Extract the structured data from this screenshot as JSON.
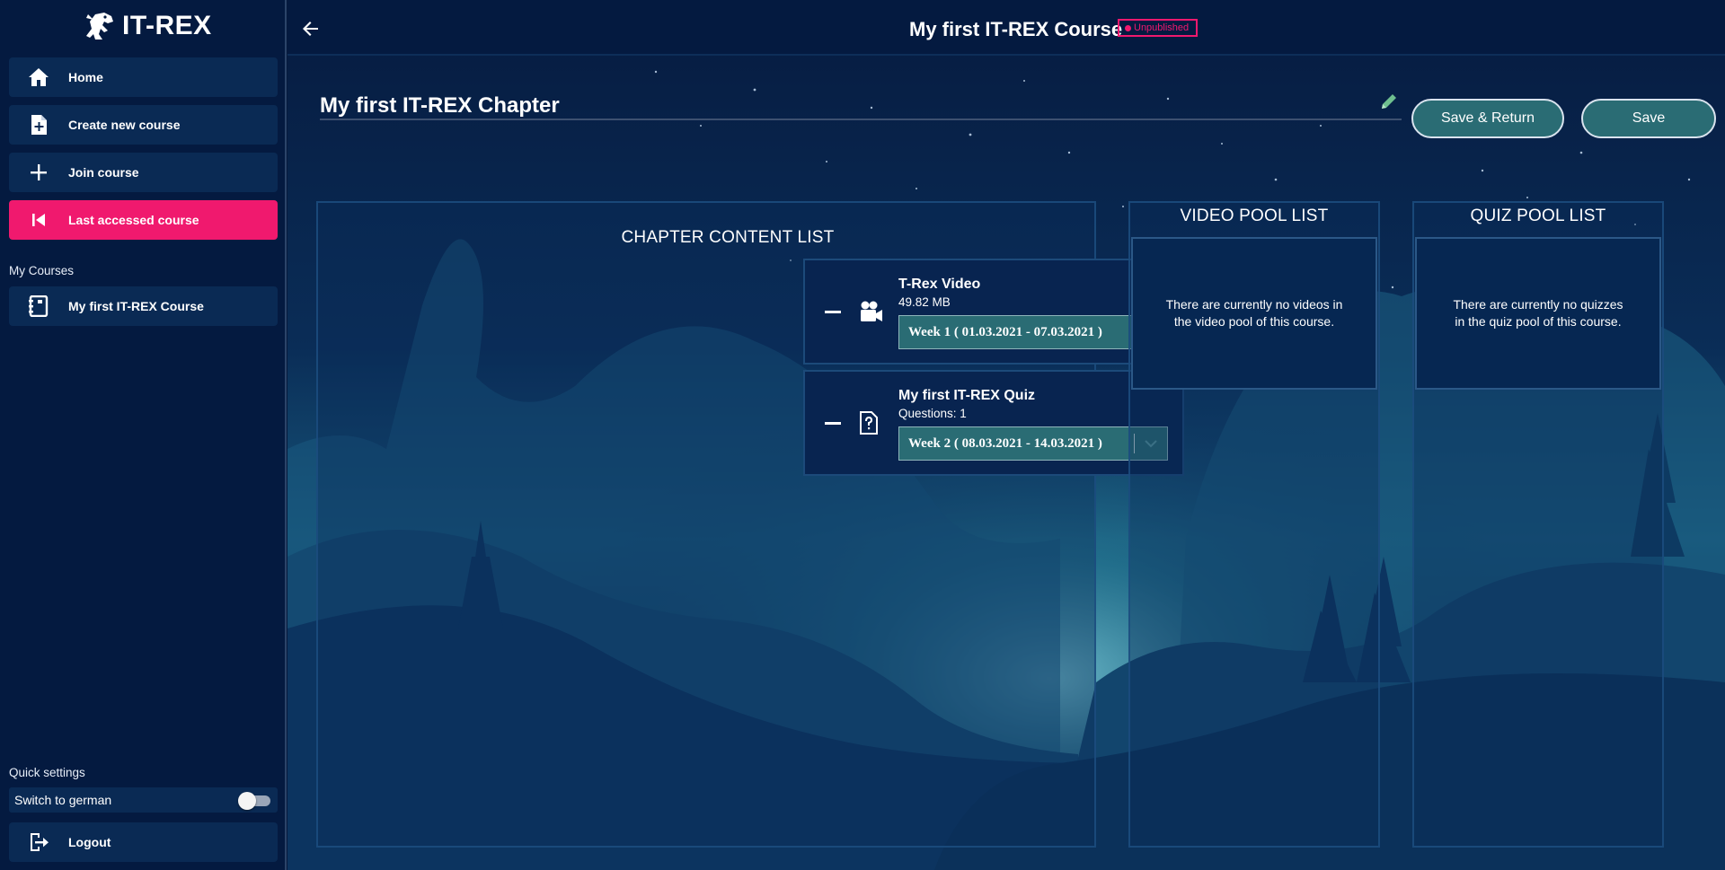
{
  "sidebar": {
    "brand": "IT-REX",
    "nav": [
      {
        "label": "Home",
        "icon": "home-icon"
      },
      {
        "label": "Create new course",
        "icon": "file-plus-icon"
      },
      {
        "label": "Join course",
        "icon": "plus-icon"
      },
      {
        "label": "Last accessed course",
        "icon": "skip-back-icon"
      }
    ],
    "my_courses_heading": "My Courses",
    "courses": [
      {
        "label": "My first IT-REX Course",
        "icon": "notebook-icon"
      }
    ],
    "quick_settings_heading": "Quick settings",
    "language_toggle": {
      "label": "Switch to german",
      "on": false
    },
    "logout_label": "Logout"
  },
  "header": {
    "course_title": "My first IT-REX Course",
    "status": "Unpublished"
  },
  "chapter": {
    "title": "My first IT-REX Chapter",
    "save_return_label": "Save & Return",
    "save_label": "Save"
  },
  "content_list": {
    "title": "CHAPTER CONTENT LIST",
    "items": [
      {
        "name": "T-Rex Video",
        "meta": "49.82 MB",
        "week": "Week 1 ( 01.03.2021 - 07.03.2021 )",
        "icon": "video-camera-icon"
      },
      {
        "name": "My first IT-REX Quiz",
        "meta": "Questions:  1",
        "week": "Week 2 ( 08.03.2021 - 14.03.2021 )",
        "icon": "quiz-file-icon"
      }
    ]
  },
  "video_pool": {
    "title": "VIDEO POOL LIST",
    "empty_message": "There are currently no videos in the video pool of this course."
  },
  "quiz_pool": {
    "title": "QUIZ POOL LIST",
    "empty_message": "There are currently no quizzes in the quiz pool of this course."
  },
  "colors": {
    "accent_pink": "#f0196e",
    "button_teal": "#2a6c74",
    "sidebar_bg": "#041a40",
    "nav_item_bg": "#0a2a54"
  }
}
